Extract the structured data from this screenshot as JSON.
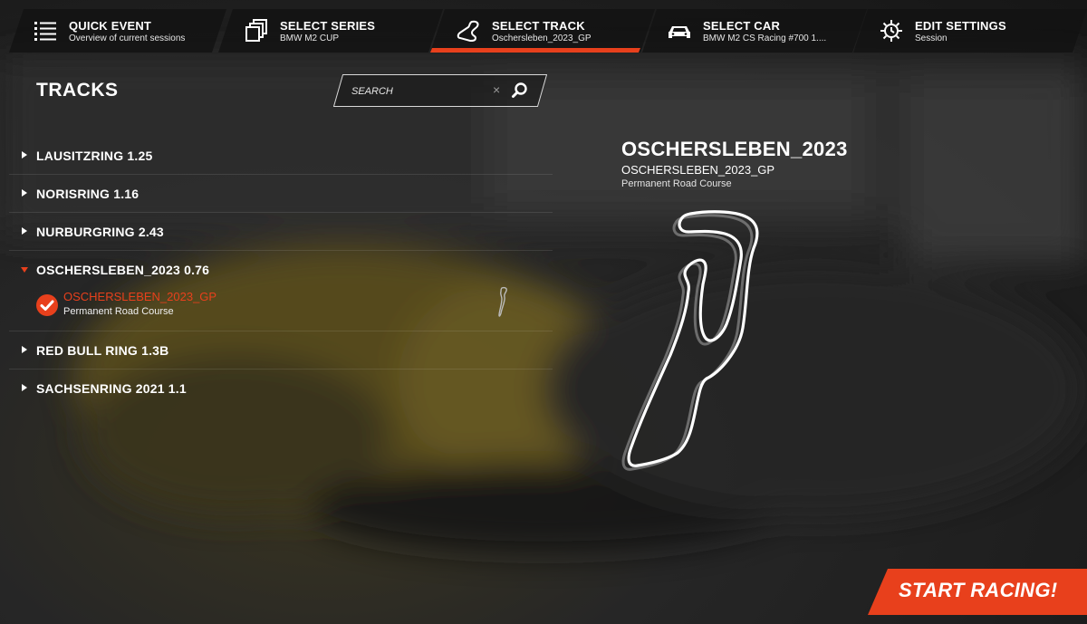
{
  "nav": {
    "tabs": [
      {
        "title": "QUICK EVENT",
        "subtitle": "Overview of current sessions",
        "icon": "list-icon",
        "active": false
      },
      {
        "title": "SELECT SERIES",
        "subtitle": "BMW M2 CUP",
        "icon": "series-cards-icon",
        "active": false
      },
      {
        "title": "SELECT TRACK",
        "subtitle": "Oschersleben_2023_GP",
        "icon": "track-icon",
        "active": true
      },
      {
        "title": "SELECT CAR",
        "subtitle": "BMW M2 CS Racing #700 1....",
        "icon": "car-icon",
        "active": false
      },
      {
        "title": "EDIT SETTINGS",
        "subtitle": "Session",
        "icon": "gear-icon",
        "active": false
      }
    ]
  },
  "tracks": {
    "title": "TRACKS",
    "search": {
      "placeholder": "SEARCH",
      "value": "",
      "clear": "×"
    },
    "list": [
      {
        "name": "LAUSITZRING 1.25",
        "expanded": false
      },
      {
        "name": "NORISRING 1.16",
        "expanded": false
      },
      {
        "name": "NURBURGRING 2.43",
        "expanded": false
      },
      {
        "name": "OSCHERSLEBEN_2023 0.76",
        "expanded": true,
        "layouts": [
          {
            "name": "OSCHERSLEBEN_2023_GP",
            "type": "Permanent Road Course",
            "selected": true
          }
        ]
      },
      {
        "name": "RED BULL RING 1.3B",
        "expanded": false
      },
      {
        "name": "SACHSENRING 2021 1.1",
        "expanded": false
      }
    ]
  },
  "detail": {
    "track_name": "OSCHERSLEBEN_2023",
    "layout_name": "OSCHERSLEBEN_2023_GP",
    "layout_type": "Permanent Road Course"
  },
  "start_button": {
    "label": "START RACING!"
  },
  "colors": {
    "accent": "#e8401c",
    "tab_bg": "#121212",
    "text": "#ffffff"
  }
}
